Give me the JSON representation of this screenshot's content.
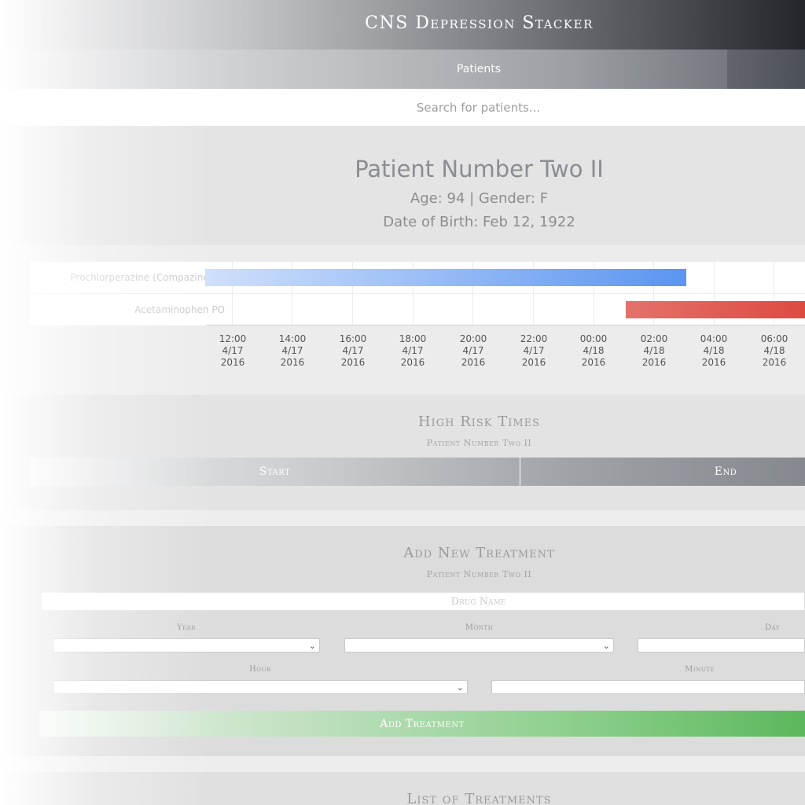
{
  "app": {
    "title": "CNS Depression Stacker"
  },
  "nav": {
    "patients_label": "Patients"
  },
  "search": {
    "placeholder": "Search for patients..."
  },
  "patient": {
    "name": "Patient Number Two II",
    "age_gender": "Age: 94 | Gender: F",
    "dob": "Date of Birth: Feb 12, 1922"
  },
  "timeline": {
    "rows": [
      {
        "label": "Prochlorperazine (Compazine) IV",
        "color": "#5b95f0"
      },
      {
        "label": "Acetaminophen PO",
        "color": "#de4a40"
      }
    ],
    "ticks": [
      {
        "time": "12:00",
        "date": "4/17",
        "year": "2016"
      },
      {
        "time": "14:00",
        "date": "4/17",
        "year": "2016"
      },
      {
        "time": "16:00",
        "date": "4/17",
        "year": "2016"
      },
      {
        "time": "18:00",
        "date": "4/17",
        "year": "2016"
      },
      {
        "time": "20:00",
        "date": "4/17",
        "year": "2016"
      },
      {
        "time": "22:00",
        "date": "4/17",
        "year": "2016"
      },
      {
        "time": "00:00",
        "date": "4/18",
        "year": "2016"
      },
      {
        "time": "02:00",
        "date": "4/18",
        "year": "2016"
      },
      {
        "time": "04:00",
        "date": "4/18",
        "year": "2016"
      },
      {
        "time": "06:00",
        "date": "4/18",
        "year": "2016"
      }
    ]
  },
  "high_risk": {
    "title": "High Risk Times",
    "subtitle": "Patient Number Two II",
    "start_label": "Start",
    "end_label": "End"
  },
  "add_treatment": {
    "title": "Add New Treatment",
    "subtitle": "Patient Number Two II",
    "drug_placeholder": "Drug Name",
    "year_label": "Year",
    "month_label": "Month",
    "day_label": "Day",
    "hour_label": "Hour",
    "minute_label": "Minute",
    "button_label": "Add Treatment"
  },
  "list": {
    "title": "List of Treatments"
  }
}
